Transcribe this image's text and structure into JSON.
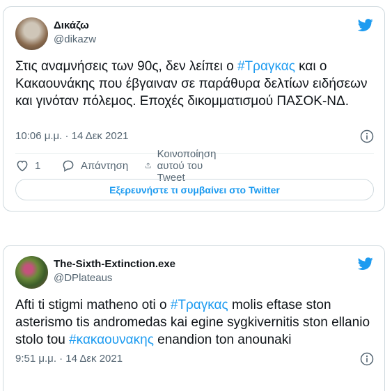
{
  "tweets": [
    {
      "display_name": "Δικάζω",
      "handle": "@dikazw",
      "text_parts": [
        {
          "t": "Στις αναμνήσεις των 90ς, δεν λείπει ο  ",
          "tag": false
        },
        {
          "t": "#Τραγκας",
          "tag": true
        },
        {
          "t": " και ο Κακαουνάκης που έβγαιναν σε παράθυρα δελτίων ειδήσεων και γινόταν πόλεμος. Εποχές δικομματισμού ΠΑΣΟΚ-ΝΔ.",
          "tag": false
        }
      ],
      "timestamp": "10:06 μ.μ. · 14 Δεκ 2021",
      "like_count": "1",
      "reply_label": "Απάντηση",
      "share_label": "Κοινοποίηση αυτού του Tweet",
      "explore_label": "Εξερευνήστε τι συμβαίνει στο Twitter"
    },
    {
      "display_name": "The-Sixth-Extinction.exe",
      "handle": "@DPlateaus",
      "text_parts": [
        {
          "t": "Afti ti stigmi matheno oti o ",
          "tag": false
        },
        {
          "t": "#Τραγκας",
          "tag": true
        },
        {
          "t": " molis eftase ston asterismo tis andromedas kai egine sygkivernitis ston ellanio stolo tou ",
          "tag": false
        },
        {
          "t": "#κακαουνακης",
          "tag": true
        },
        {
          "t": " enandion ton anounaki",
          "tag": false
        }
      ],
      "timestamp": "9:51 μ.μ. · 14 Δεκ 2021"
    }
  ],
  "colors": {
    "accent": "#1d9bf0",
    "text": "#0f1419",
    "muted": "#536471",
    "border": "#cfd9de"
  },
  "icons": [
    "twitter-bird-icon",
    "info-icon",
    "heart-icon",
    "reply-bubble-icon",
    "share-icon"
  ]
}
